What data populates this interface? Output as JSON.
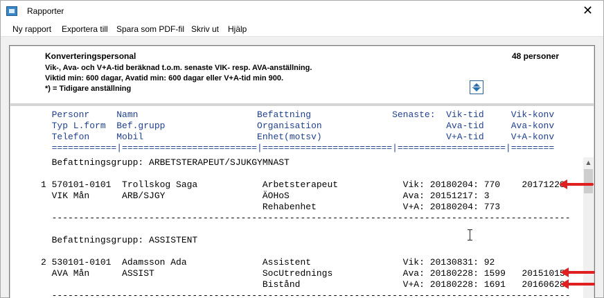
{
  "window": {
    "title": "Rapporter",
    "close_glyph": "✕"
  },
  "menu": [
    "Ny rapport",
    "Exportera till",
    "Spara som PDF-fil",
    "Skriv ut",
    "Hjälp"
  ],
  "header": {
    "title": "Konverteringspersonal",
    "count": "48 personer",
    "lines": [
      "Vik-, Ava- och V+A-tid beräknad t.o.m. senaste VIK- resp. AVA-anställning.",
      "Viktid min: 600 dagar, Avatid min: 600 dagar eller V+A-tid min 900.",
      "*) = Tidigare anställning"
    ],
    "sort_icon": "sort-up-down-icon"
  },
  "report": {
    "columns": [
      "  Personr     Namn                      Befattning               Senaste:  Vik-tid     Vik-konv",
      "  Typ L.form  Bef.grupp                 Organisation                       Ava-tid     Ava-konv",
      "  Telefon     Mobil                     Enhet(motsv)                       V+A-tid     V+A-konv",
      "  ============|=========================|========================|====================|========"
    ],
    "groups": [
      {
        "heading": "  Befattningsgrupp: ARBETSTERAPEUT/SJUKGYMNAST",
        "lines": [
          "1 570101-0101  Trollskog Saga            Arbetsterapeut            Vik: 20180204: 770    20171228",
          "  VIK Mån      ARB/SJGY                  ÄOHoS                     Ava: 20151217: 3",
          "                                         Rehabenhet                V+A: 20180204: 773"
        ],
        "separator": "  ------------------------------------------------------------------------------------------------"
      },
      {
        "heading": "  Befattningsgrupp: ASSISTENT",
        "lines": [
          "2 530101-0101  Adamsson Ada              Assistent                 Vik: 20130831: 92",
          "  AVA Mån      ASSIST                    SocUtrednings             Ava: 20180228: 1599   20151015",
          "                                         Bistånd                   V+A: 20180228: 1691   20160628"
        ],
        "separator": "  ------------------------------------------------------------------------------------------------"
      }
    ]
  },
  "colors": {
    "header_text": "#1f3f8f",
    "arrow": "#e02020"
  }
}
